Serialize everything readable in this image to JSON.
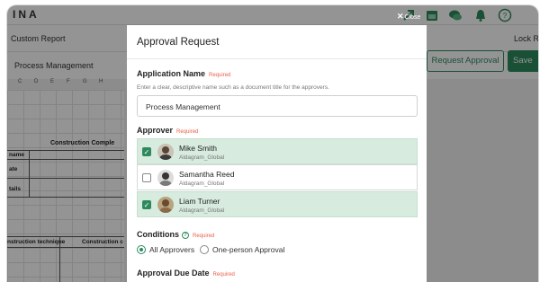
{
  "app": {
    "logo": "INA",
    "report_title": "Custom Report",
    "lock_label": "Lock R",
    "document_name": "Process Management",
    "request_button": "Request Approval",
    "save_button": "Save",
    "columns": [
      "C",
      "D",
      "E",
      "F",
      "G",
      "H"
    ],
    "sheet_title": "Construction Comple",
    "sheet_rows": [
      "name",
      "ate",
      "tails"
    ],
    "sheet_headers": [
      "nstruction technique",
      "Construction c"
    ],
    "header_icons": [
      "share-icon",
      "calendar-icon",
      "chat-icon",
      "bell-icon",
      "help-icon"
    ]
  },
  "modal": {
    "close_label": "Close",
    "title": "Approval Request",
    "required_tag": "Required",
    "application_name": {
      "label": "Application Name",
      "help": "Enter a clear, descriptive name such as a document title for the approvers.",
      "value": "Process Management"
    },
    "approver": {
      "label": "Approver",
      "items": [
        {
          "name": "Mike Smith",
          "org": "Aldagram_Global",
          "checked": true
        },
        {
          "name": "Samantha Reed",
          "org": "Aldagram_Global",
          "checked": false
        },
        {
          "name": "Liam Turner",
          "org": "Aldagram_Global",
          "checked": true
        }
      ]
    },
    "conditions": {
      "label": "Conditions",
      "options": [
        "All Approvers",
        "One-person Approval"
      ],
      "selected": "All Approvers"
    },
    "due_date": {
      "label": "Approval Due Date"
    }
  },
  "colors": {
    "accent": "#2e8a5e",
    "required": "#e8604c",
    "selected_row": "#d7ebdf"
  }
}
